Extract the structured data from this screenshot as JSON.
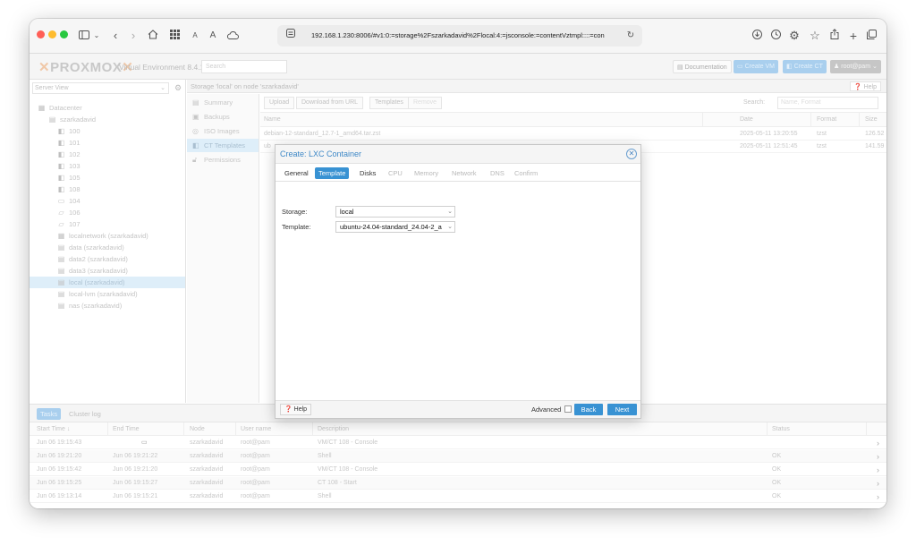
{
  "browser": {
    "url": "192.168.1.230:8006/#v1:0:=storage%2Fszarkadavid%2Flocal:4:=jsconsole:=contentVztmpl::::=con"
  },
  "header": {
    "logo": "PROXMOX",
    "product": "Virtual Environment 8.4.1",
    "search_placeholder": "Search",
    "documentation": "Documentation",
    "create_vm": "Create VM",
    "create_ct": "Create CT",
    "user": "root@pam"
  },
  "sidebar": {
    "view": "Server View",
    "tree": [
      {
        "label": "Datacenter",
        "icon": "datacenter-icon"
      },
      {
        "label": "szarkadavid",
        "icon": "node-icon"
      },
      {
        "label": "100",
        "icon": "container-icon"
      },
      {
        "label": "101",
        "icon": "container-icon"
      },
      {
        "label": "102",
        "icon": "container-icon"
      },
      {
        "label": "103",
        "icon": "container-icon"
      },
      {
        "label": "105",
        "icon": "container-icon"
      },
      {
        "label": "108",
        "icon": "container-icon"
      },
      {
        "label": "104",
        "icon": "vm-icon"
      },
      {
        "label": "106",
        "icon": "template-icon"
      },
      {
        "label": "107",
        "icon": "template-icon"
      },
      {
        "label": "localnetwork (szarkadavid)",
        "icon": "network-icon"
      },
      {
        "label": "data (szarkadavid)",
        "icon": "storage-icon"
      },
      {
        "label": "data2 (szarkadavid)",
        "icon": "storage-icon"
      },
      {
        "label": "data3 (szarkadavid)",
        "icon": "storage-icon"
      },
      {
        "label": "local (szarkadavid)",
        "icon": "storage-icon"
      },
      {
        "label": "local-lvm (szarkadavid)",
        "icon": "storage-icon"
      },
      {
        "label": "nas (szarkadavid)",
        "icon": "storage-icon"
      }
    ]
  },
  "content": {
    "title": "Storage 'local' on node 'szarkadavid'",
    "help": "Help",
    "menu": [
      "Summary",
      "Backups",
      "ISO Images",
      "CT Templates",
      "Permissions"
    ],
    "toolbar": {
      "upload": "Upload",
      "download": "Download from URL",
      "templates": "Templates",
      "remove": "Remove",
      "search_label": "Search:",
      "search_placeholder": "Name, Format"
    },
    "columns": [
      "Name",
      "Date",
      "Format",
      "Size"
    ],
    "rows": [
      {
        "name": "debian-12-standard_12.7-1_amd64.tar.zst",
        "date": "2025-05-11 13:20:55",
        "format": "tzst",
        "size": "126.52 MB"
      },
      {
        "name": "ub",
        "date": "2025-05-11 12:51:45",
        "format": "tzst",
        "size": "141.59 MB"
      }
    ]
  },
  "tasks": {
    "tabs": [
      "Tasks",
      "Cluster log"
    ],
    "columns": [
      "Start Time ↓",
      "End Time",
      "Node",
      "User name",
      "Description",
      "Status"
    ],
    "rows": [
      {
        "start": "Jun 06 19:15:43",
        "end": "",
        "node": "szarkadavid",
        "user": "root@pam",
        "desc": "VM/CT 108 - Console",
        "status": ""
      },
      {
        "start": "Jun 06 19:21:20",
        "end": "Jun 06 19:21:22",
        "node": "szarkadavid",
        "user": "root@pam",
        "desc": "Shell",
        "status": "OK"
      },
      {
        "start": "Jun 06 19:15:42",
        "end": "Jun 06 19:21:20",
        "node": "szarkadavid",
        "user": "root@pam",
        "desc": "VM/CT 108 - Console",
        "status": "OK"
      },
      {
        "start": "Jun 06 19:15:25",
        "end": "Jun 06 19:15:27",
        "node": "szarkadavid",
        "user": "root@pam",
        "desc": "CT 108 - Start",
        "status": "OK"
      },
      {
        "start": "Jun 06 19:13:14",
        "end": "Jun 06 19:15:21",
        "node": "szarkadavid",
        "user": "root@pam",
        "desc": "Shell",
        "status": "OK"
      }
    ]
  },
  "dialog": {
    "title": "Create: LXC Container",
    "tabs": [
      "General",
      "Template",
      "Disks",
      "CPU",
      "Memory",
      "Network",
      "DNS",
      "Confirm"
    ],
    "storage_label": "Storage:",
    "storage_value": "local",
    "template_label": "Template:",
    "template_value": "ubuntu-24.04-standard_24.04-2_a",
    "help": "Help",
    "advanced": "Advanced",
    "back": "Back",
    "next": "Next"
  },
  "colors": {
    "accent": "#3892d3",
    "title": "#3c87c6"
  }
}
